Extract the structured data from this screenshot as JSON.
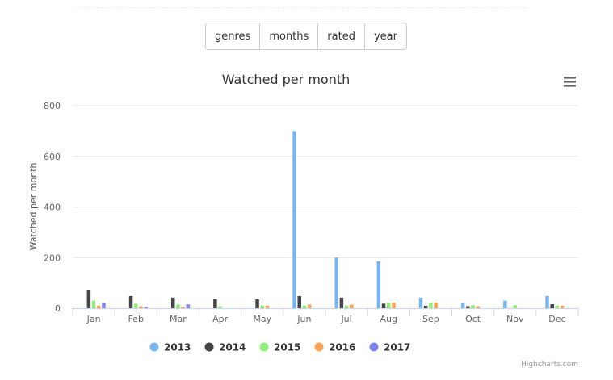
{
  "nav": {
    "buttons": [
      {
        "label": "genres"
      },
      {
        "label": "months"
      },
      {
        "label": "rated"
      },
      {
        "label": "year"
      }
    ]
  },
  "credit": "Highcharts.com",
  "chart_data": {
    "type": "bar",
    "title": "Watched per month",
    "xlabel": "",
    "ylabel": "Watched per month",
    "ylim": [
      0,
      800
    ],
    "yticks": [
      0,
      200,
      400,
      600,
      800
    ],
    "grid": true,
    "legend_placement": "bottom-center",
    "categories": [
      "Jan",
      "Feb",
      "Mar",
      "Apr",
      "May",
      "Jun",
      "Jul",
      "Aug",
      "Sep",
      "Oct",
      "Nov",
      "Dec"
    ],
    "series": [
      {
        "name": "2013",
        "color": "#7cb5ec",
        "values": [
          0,
          0,
          0,
          0,
          0,
          700,
          200,
          185,
          42,
          20,
          30,
          48
        ]
      },
      {
        "name": "2014",
        "color": "#434348",
        "values": [
          70,
          48,
          42,
          36,
          35,
          48,
          42,
          18,
          10,
          8,
          0,
          16
        ]
      },
      {
        "name": "2015",
        "color": "#90ed7d",
        "values": [
          30,
          18,
          15,
          8,
          10,
          10,
          10,
          22,
          20,
          12,
          12,
          10
        ]
      },
      {
        "name": "2016",
        "color": "#f7a35c",
        "values": [
          10,
          8,
          5,
          0,
          10,
          15,
          15,
          22,
          22,
          8,
          0,
          10
        ]
      },
      {
        "name": "2017",
        "color": "#8085e9",
        "values": [
          20,
          5,
          15,
          0,
          0,
          0,
          0,
          0,
          0,
          0,
          0,
          0
        ]
      }
    ]
  }
}
